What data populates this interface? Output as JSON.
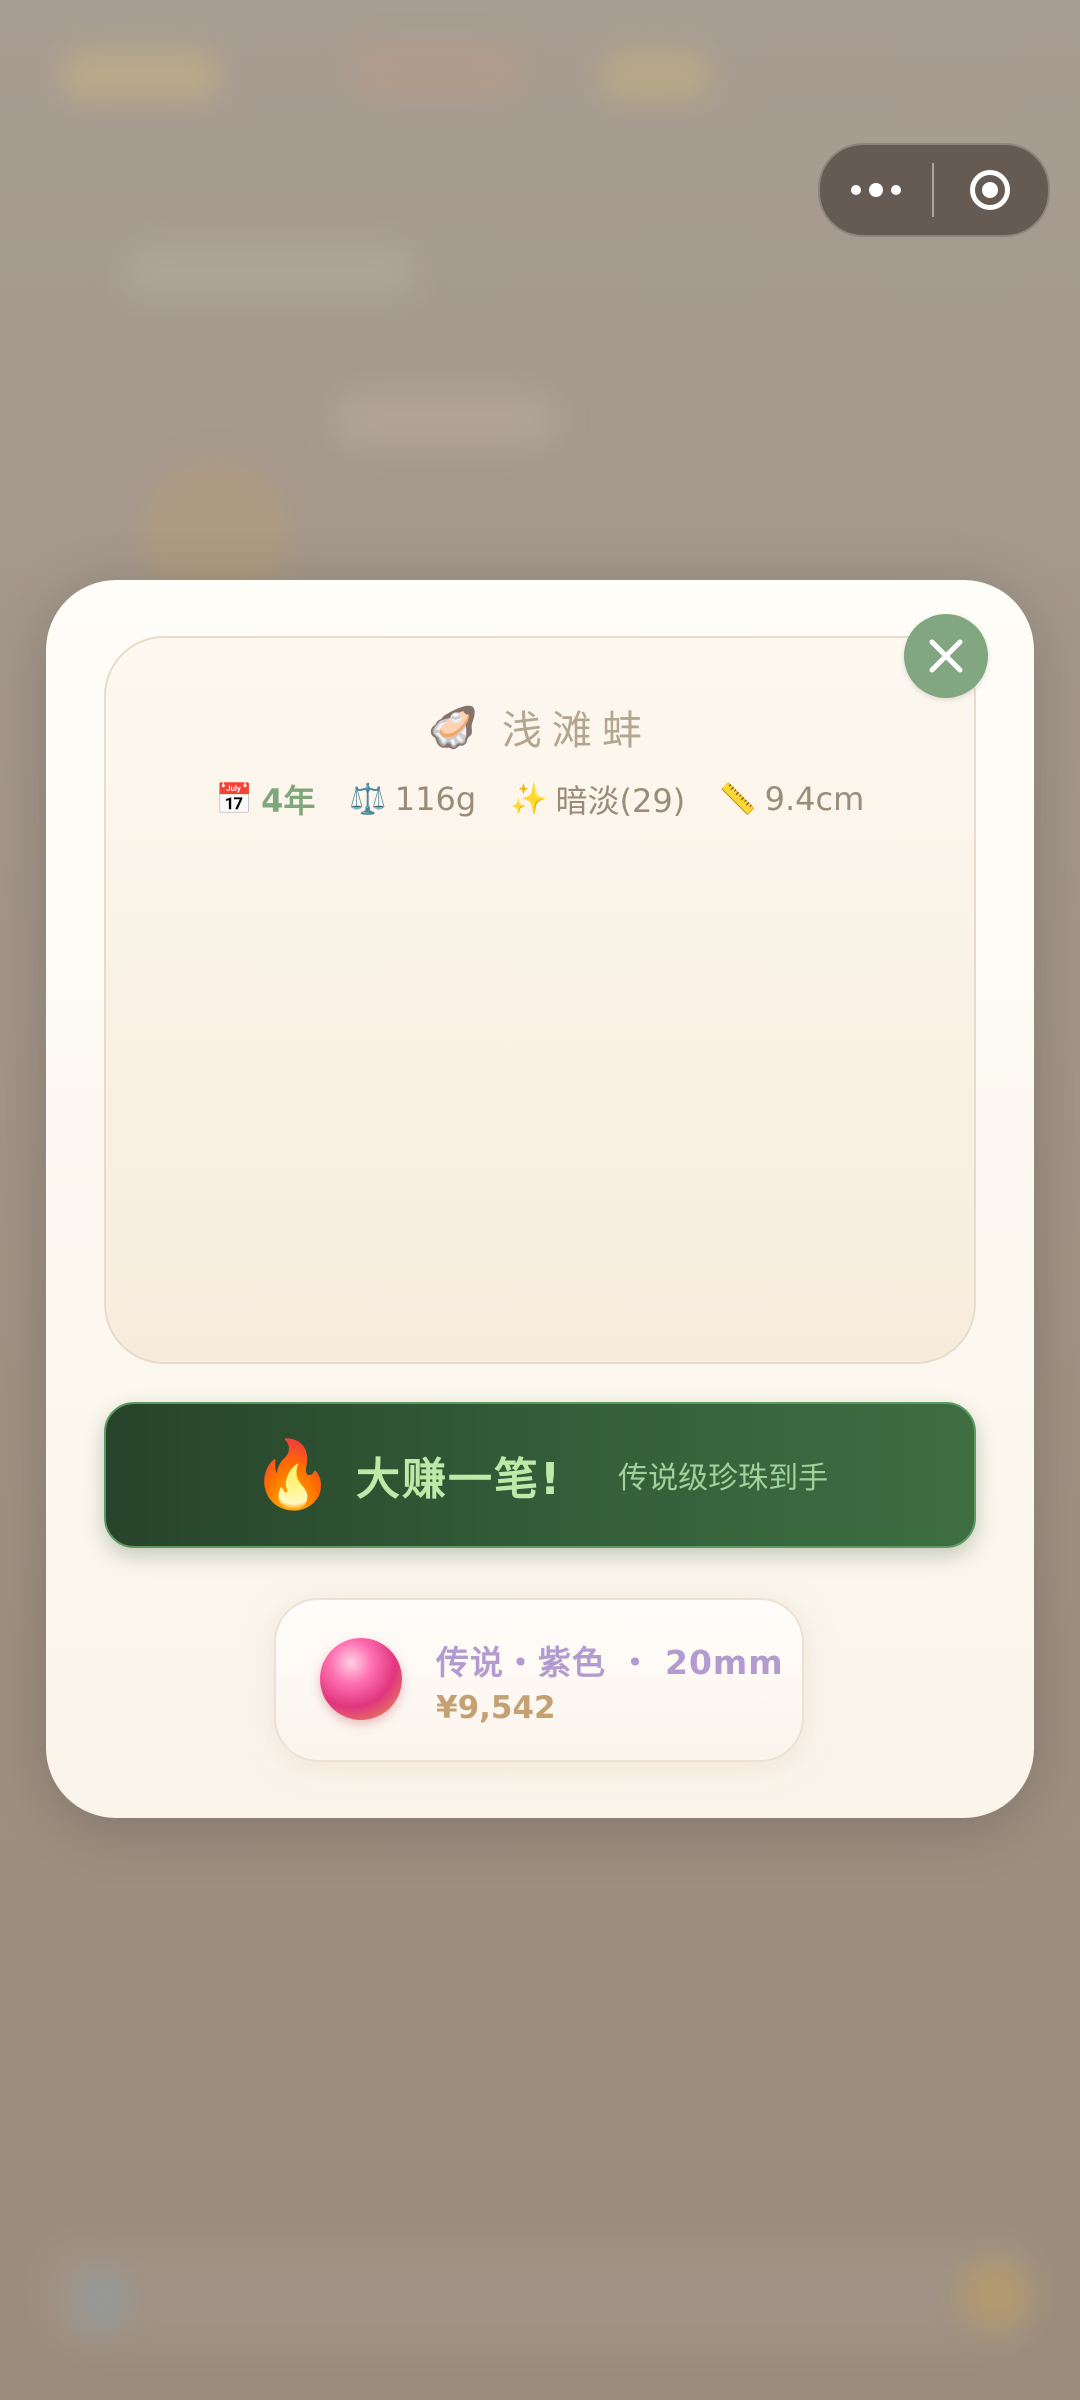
{
  "capsule": {
    "more_icon": "more-dots-icon",
    "target_icon": "target-circle-icon"
  },
  "shell": {
    "icon": "🦪",
    "name": "浅滩蚌",
    "stats": {
      "age": {
        "icon": "📅",
        "value": "4年"
      },
      "weight": {
        "icon": "⚖️",
        "value": "116g"
      },
      "luster": {
        "icon": "✨",
        "value": "暗淡(29)"
      },
      "size": {
        "icon": "📏",
        "value": "9.4cm"
      }
    }
  },
  "close_button": {
    "icon": "close-icon"
  },
  "result": {
    "icon": "🔥",
    "title": "大赚一笔!",
    "subtitle": "传说级珍珠到手"
  },
  "pearl": {
    "description": "传说・紫色 ・ 20mm",
    "price": "¥9,542"
  },
  "colors": {
    "accent_green": "#82a67f",
    "banner_dark": "#27432b",
    "pearl_text": "#b39bcf",
    "price_text": "#c4a173"
  }
}
